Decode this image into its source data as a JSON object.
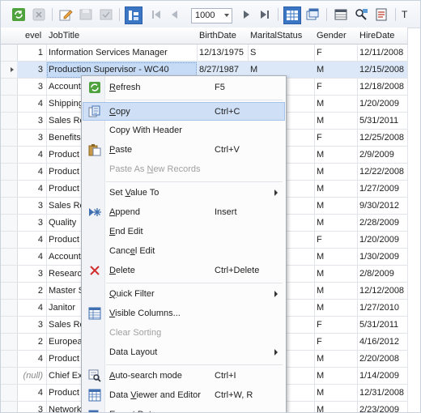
{
  "toolbar": {
    "rows_value": "1000",
    "right_text": "T",
    "buttons": [
      "refresh-icon",
      "cancel-icon",
      "edit-icon",
      "save-icon",
      "apply-icon",
      "filter-active-icon",
      "first-icon",
      "prev-icon",
      "next-icon",
      "last-icon",
      "grid-view-icon",
      "form-view-icon",
      "columns-icon",
      "find-icon",
      "text-view-icon"
    ]
  },
  "grid": {
    "headers": [
      "evel",
      "JobTitle",
      "BirthDate",
      "MaritalStatus",
      "Gender",
      "HireDate"
    ],
    "rows": [
      {
        "level": "1",
        "job": "Information Services Manager",
        "birth": "12/13/1975",
        "marital": "S",
        "gender": "F",
        "hire": "12/11/2008"
      },
      {
        "level": "3",
        "job": "Production Supervisor - WC40",
        "birth": "8/27/1987",
        "marital": "M",
        "gender": "M",
        "hire": "12/15/2008"
      },
      {
        "level": "3",
        "job": "Account",
        "birth": "",
        "marital": "",
        "gender": "F",
        "hire": "12/18/2008"
      },
      {
        "level": "4",
        "job": "Shipping",
        "birth": "",
        "marital": "",
        "gender": "M",
        "hire": "1/20/2009"
      },
      {
        "level": "3",
        "job": "Sales Re",
        "birth": "",
        "marital": "",
        "gender": "M",
        "hire": "5/31/2011"
      },
      {
        "level": "3",
        "job": "Benefits",
        "birth": "",
        "marital": "",
        "gender": "F",
        "hire": "12/25/2008"
      },
      {
        "level": "4",
        "job": "Product",
        "birth": "",
        "marital": "",
        "gender": "M",
        "hire": "2/9/2009"
      },
      {
        "level": "4",
        "job": "Product",
        "birth": "",
        "marital": "",
        "gender": "M",
        "hire": "12/22/2008"
      },
      {
        "level": "4",
        "job": "Product",
        "birth": "",
        "marital": "",
        "gender": "M",
        "hire": "1/27/2009"
      },
      {
        "level": "3",
        "job": "Sales Re",
        "birth": "",
        "marital": "",
        "gender": "M",
        "hire": "9/30/2012"
      },
      {
        "level": "3",
        "job": "Quality",
        "birth": "",
        "marital": "",
        "gender": "M",
        "hire": "2/28/2009"
      },
      {
        "level": "4",
        "job": "Product",
        "birth": "",
        "marital": "",
        "gender": "F",
        "hire": "1/20/2009"
      },
      {
        "level": "4",
        "job": "Account",
        "birth": "",
        "marital": "",
        "gender": "M",
        "hire": "1/30/2009"
      },
      {
        "level": "3",
        "job": "Researc",
        "birth": "",
        "marital": "",
        "gender": "M",
        "hire": "2/8/2009"
      },
      {
        "level": "2",
        "job": "Master S",
        "birth": "",
        "marital": "",
        "gender": "M",
        "hire": "12/12/2008"
      },
      {
        "level": "4",
        "job": "Janitor",
        "birth": "",
        "marital": "",
        "gender": "M",
        "hire": "1/27/2010"
      },
      {
        "level": "3",
        "job": "Sales Re",
        "birth": "",
        "marital": "",
        "gender": "F",
        "hire": "5/31/2011"
      },
      {
        "level": "2",
        "job": "Europea",
        "birth": "",
        "marital": "",
        "gender": "F",
        "hire": "4/16/2012"
      },
      {
        "level": "4",
        "job": "Product",
        "birth": "",
        "marital": "",
        "gender": "M",
        "hire": "2/20/2008"
      },
      {
        "level": "(null)",
        "job": "Chief Ex",
        "birth": "",
        "marital": "",
        "gender": "M",
        "hire": "1/14/2009"
      },
      {
        "level": "4",
        "job": "Product",
        "birth": "",
        "marital": "",
        "gender": "M",
        "hire": "12/31/2008"
      },
      {
        "level": "3",
        "job": "Network",
        "birth": "",
        "marital": "",
        "gender": "M",
        "hire": "2/23/2009"
      }
    ]
  },
  "menu": {
    "items": [
      {
        "type": "item",
        "label": "Refresh",
        "shortcut": "F5",
        "icon": "refresh-icon",
        "underline": 0
      },
      {
        "type": "sep"
      },
      {
        "type": "item",
        "label": "Copy",
        "shortcut": "Ctrl+C",
        "icon": "copy-icon",
        "highlight": true,
        "underline": 0
      },
      {
        "type": "item",
        "label": "Copy With Header",
        "shortcut": "",
        "icon": ""
      },
      {
        "type": "item",
        "label": "Paste",
        "shortcut": "Ctrl+V",
        "icon": "paste-icon",
        "underline": 0
      },
      {
        "type": "item",
        "label": "Paste As New Records",
        "shortcut": "",
        "icon": "",
        "disabled": true,
        "underline": 9
      },
      {
        "type": "sep"
      },
      {
        "type": "item",
        "label": "Set Value To",
        "shortcut": "",
        "icon": "",
        "submenu": true,
        "underline": 4
      },
      {
        "type": "item",
        "label": "Append",
        "shortcut": "Insert",
        "icon": "append-icon",
        "underline": 0
      },
      {
        "type": "item",
        "label": "End Edit",
        "shortcut": "",
        "icon": "",
        "underline": 0
      },
      {
        "type": "item",
        "label": "Cancel Edit",
        "shortcut": "",
        "icon": "",
        "underline": 4
      },
      {
        "type": "item",
        "label": "Delete",
        "shortcut": "Ctrl+Delete",
        "icon": "delete-icon",
        "underline": 0
      },
      {
        "type": "sep"
      },
      {
        "type": "item",
        "label": "Quick Filter",
        "shortcut": "",
        "icon": "",
        "submenu": true,
        "underline": 0
      },
      {
        "type": "item",
        "label": "Visible Columns...",
        "shortcut": "",
        "icon": "columns-icon",
        "underline": 0
      },
      {
        "type": "item",
        "label": "Clear Sorting",
        "shortcut": "",
        "icon": "",
        "disabled": true
      },
      {
        "type": "item",
        "label": "Data Layout",
        "shortcut": "",
        "icon": "",
        "submenu": true
      },
      {
        "type": "sep"
      },
      {
        "type": "item",
        "label": "Auto-search mode",
        "shortcut": "Ctrl+I",
        "icon": "search-mode-icon",
        "underline": 0
      },
      {
        "type": "item",
        "label": "Data Viewer and Editor",
        "shortcut": "Ctrl+W, R",
        "icon": "viewer-icon",
        "underline": 5
      },
      {
        "type": "item",
        "label": "Export Data...",
        "shortcut": "",
        "icon": "export-icon",
        "underline": 1
      }
    ]
  }
}
